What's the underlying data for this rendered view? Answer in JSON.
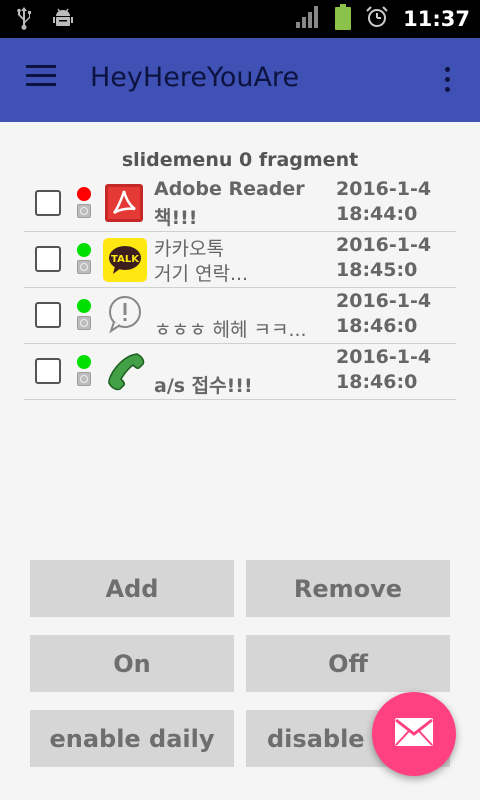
{
  "status_bar": {
    "time": "11:37",
    "icons": [
      "usb-icon",
      "android-debug-icon",
      "signal-icon",
      "battery-icon",
      "alarm-icon"
    ]
  },
  "app_bar": {
    "title": "HeyHereYouAre",
    "menu_icon": "hamburger-menu-icon",
    "more_icon": "more-vert-icon",
    "color": "#3f51b5"
  },
  "fragment_title": "slidemenu 0 fragment",
  "notifications": [
    {
      "status_color": "#ff0000",
      "app_icon": "adobe-reader-icon",
      "name": "Adobe Reader",
      "message": "책!!!",
      "date": "2016-1-4",
      "time": "18:44:0",
      "checked": false
    },
    {
      "status_color": "#00e000",
      "app_icon": "kakaotalk-icon",
      "name": "카카오톡",
      "message": "거기 연락...",
      "date": "2016-1-4",
      "time": "18:45:0",
      "checked": false
    },
    {
      "status_color": "#00e000",
      "app_icon": "sms-bubble-icon",
      "name": "",
      "message": "ㅎㅎㅎ 헤헤 ㅋㅋ...",
      "date": "2016-1-4",
      "time": "18:46:0",
      "checked": false
    },
    {
      "status_color": "#00e000",
      "app_icon": "phone-icon",
      "name": "",
      "message": "a/s 접수!!!",
      "date": "2016-1-4",
      "time": "18:46:0",
      "checked": false
    }
  ],
  "buttons": {
    "add": "Add",
    "remove": "Remove",
    "on": "On",
    "off": "Off",
    "enable_daily": "enable daily",
    "disable_daily": "disable daily"
  },
  "fab": {
    "icon": "mail-icon",
    "color": "#ff4081"
  }
}
